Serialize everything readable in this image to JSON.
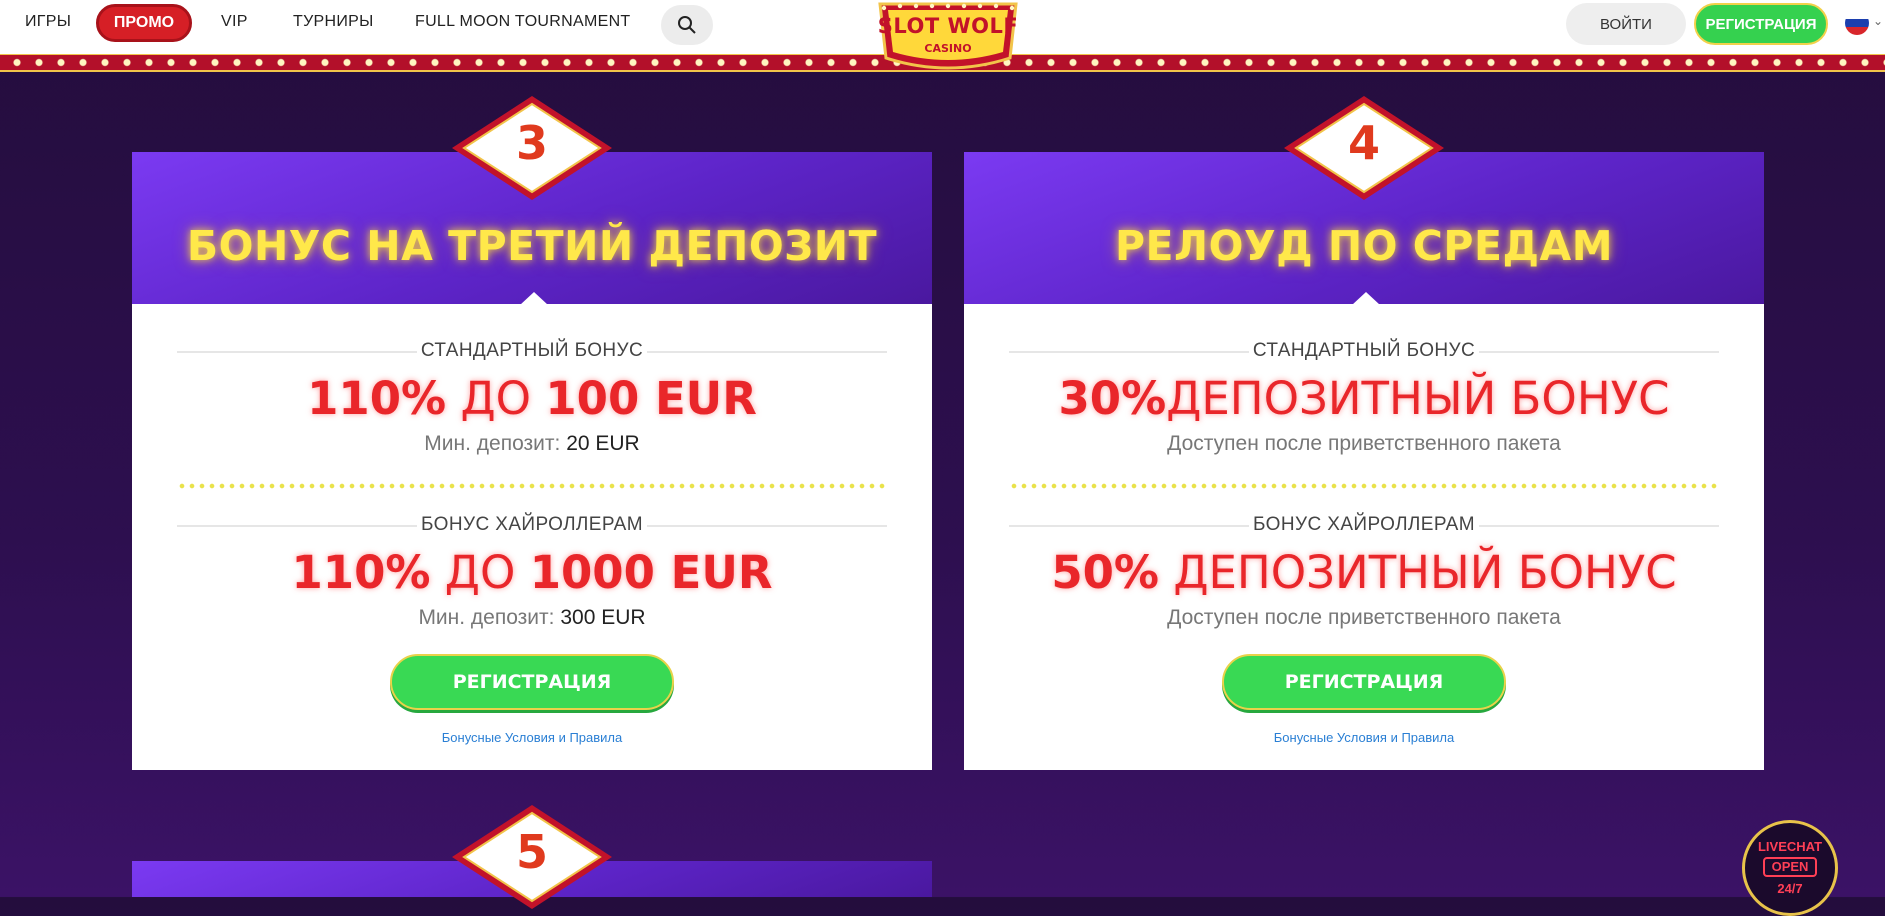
{
  "nav": {
    "games": "ИГРЫ",
    "promo": "ПРОМО",
    "vip": "VIP",
    "tournaments": "ТУРНИРЫ",
    "full_moon": "FULL MOON TOURNAMENT",
    "login": "ВОЙТИ",
    "register": "РЕГИСТРАЦИЯ"
  },
  "logo": {
    "line1": "SLOT WOLF",
    "line2": "CASINO"
  },
  "cards": [
    {
      "number": "3",
      "title": "БОНУС НА ТРЕТИЙ ДЕПОЗИТ",
      "standard_label": "СТАНДАРТНЫЙ БОНУС",
      "standard_pct": "110%",
      "standard_mid": " ДО ",
      "standard_amount": "100 EUR",
      "standard_min_label": "Мин. депозит:",
      "standard_min_value": "20 EUR",
      "high_label": "БОНУС ХАЙРОЛЛЕРАМ",
      "high_pct": "110%",
      "high_mid": " ДО ",
      "high_amount": "1000 EUR",
      "high_min_label": "Мин. депозит:",
      "high_min_value": "300 EUR",
      "button": "РЕГИСТРАЦИЯ",
      "terms": "Бонусные Условия и Правила"
    },
    {
      "number": "4",
      "title": "РЕЛОУД ПО СРЕДАМ",
      "standard_label": "СТАНДАРТНЫЙ БОНУС",
      "standard_pct": "30%",
      "standard_rest": "ДЕПОЗИТНЫЙ БОНУС",
      "standard_note": "Доступен после приветственного пакета",
      "high_label": "БОНУС ХАЙРОЛЛЕРАМ",
      "high_pct": "50%",
      "high_rest": " ДЕПОЗИТНЫЙ БОНУС",
      "high_note": "Доступен после приветственного пакета",
      "button": "РЕГИСТРАЦИЯ",
      "terms": "Бонусные Условия и Правила"
    },
    {
      "number": "5"
    }
  ],
  "livechat": {
    "line1": "LIVECHAT",
    "line2": "OPEN",
    "line3": "24/7"
  },
  "colors": {
    "accent_red": "#e9262a",
    "title_yellow": "#ffe84a",
    "cta_green": "#39d954",
    "header_purple": "#6a2ee0"
  }
}
